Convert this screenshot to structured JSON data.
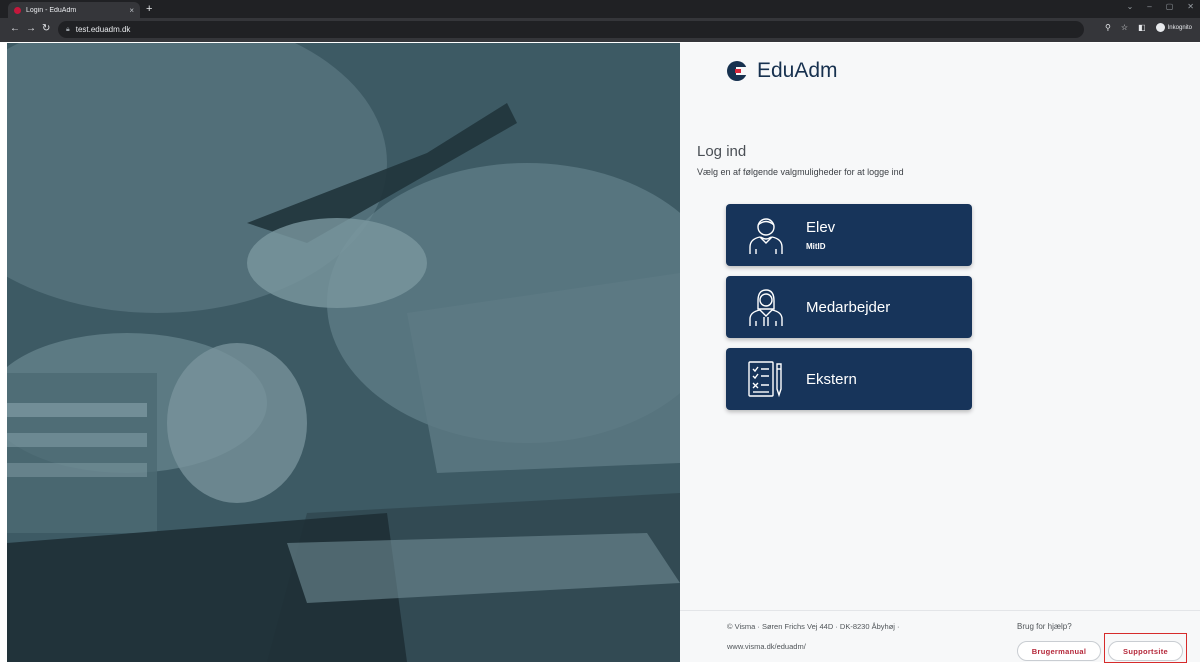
{
  "browser": {
    "tab_title": "Login - EduAdm",
    "tab_close": "×",
    "new_tab": "+",
    "url": "test.eduadm.dk",
    "incognito_label": "Inkognito",
    "win_min": "–",
    "win_restore": "▢",
    "win_close": "✕",
    "win_menu": "⌄"
  },
  "brand": {
    "name": "EduAdm"
  },
  "login": {
    "title": "Log ind",
    "subtitle": "Vælg en af følgende valgmuligheder for at logge ind",
    "options": [
      {
        "label": "Elev",
        "badge": "MitID",
        "icon": "student-icon"
      },
      {
        "label": "Medarbejder",
        "icon": "employee-icon"
      },
      {
        "label": "Ekstern",
        "icon": "external-document-icon"
      }
    ]
  },
  "footer": {
    "address_line1": "© Visma · Søren Frichs Vej 44D · DK-8230 Åbyhøj ·",
    "address_line2": "www.visma.dk/eduadm/",
    "help_label": "Brug for hjælp?",
    "manual_button": "Brugermanual",
    "support_button": "Supportsite"
  },
  "colors": {
    "brand_navy": "#17345a",
    "accent_red": "#b5283a",
    "highlight": "#d62b2b"
  }
}
